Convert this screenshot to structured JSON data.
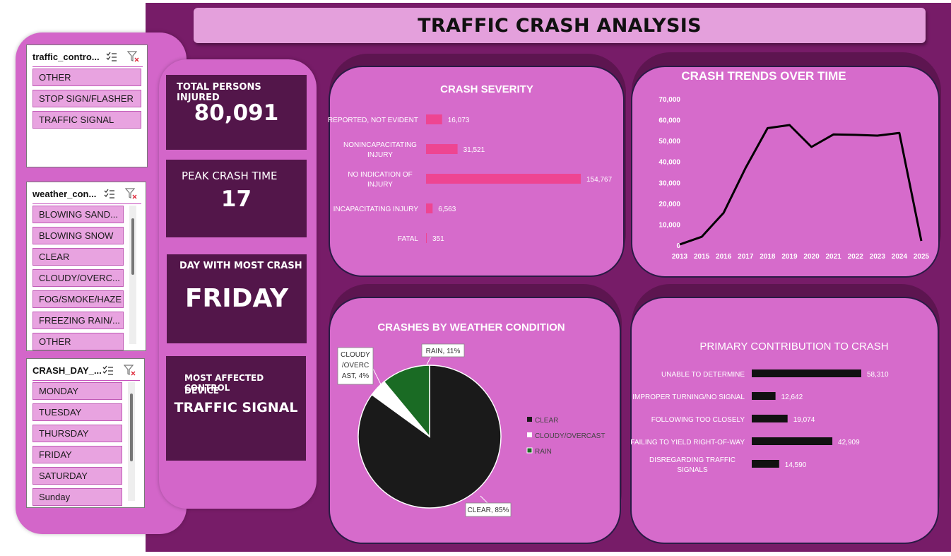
{
  "title": "TRAFFIC CRASH ANALYSIS",
  "slicers": {
    "traffic_control": {
      "title": "traffic_contro...",
      "items": [
        "OTHER",
        "STOP SIGN/FLASHER",
        "TRAFFIC SIGNAL"
      ]
    },
    "weather": {
      "title": "weather_con...",
      "items": [
        "BLOWING SAND...",
        "BLOWING SNOW",
        "CLEAR",
        "CLOUDY/OVERC...",
        "FOG/SMOKE/HAZE",
        "FREEZING RAIN/...",
        "OTHER"
      ]
    },
    "crash_day": {
      "title": "CRASH_DAY_...",
      "items": [
        "MONDAY",
        "TUESDAY",
        "THURSDAY",
        "FRIDAY",
        "SATURDAY",
        "Sunday"
      ]
    }
  },
  "kpis": {
    "injured": {
      "label": "TOTAL PERSONS INJURED",
      "value": "80,091"
    },
    "peak": {
      "label": "PEAK CRASH TIME",
      "value": "17"
    },
    "day": {
      "label": "DAY WITH MOST CRASH",
      "value": "FRIDAY"
    },
    "device": {
      "label_line1": "MOST AFFECTED CONTROL",
      "label_line2": "DEVICE",
      "value": "TRAFFIC SIGNAL"
    }
  },
  "colors": {
    "background": "#771c68",
    "card": "#d66bcb",
    "kpi": "#53164a",
    "bar_pink": "#ee4592",
    "bar_black": "#111111",
    "pie_clear": "#1a1a1a",
    "pie_cloudy": "#ffffff",
    "pie_rain": "#1a6b24"
  },
  "chart_data": [
    {
      "type": "bar",
      "title": "CRASH SEVERITY",
      "categories": [
        "REPORTED, NOT EVIDENT",
        "NONINCAPACITATING INJURY",
        "NO INDICATION OF INJURY",
        "INCAPACITATING INJURY",
        "FATAL"
      ],
      "category_lines": [
        [
          "REPORTED, NOT EVIDENT"
        ],
        [
          "NONINCAPACITATING",
          "INJURY"
        ],
        [
          "NO INDICATION OF",
          "INJURY"
        ],
        [
          "INCAPACITATING INJURY"
        ],
        [
          "FATAL"
        ]
      ],
      "values": [
        16073,
        31521,
        154767,
        6563,
        351
      ],
      "labels": [
        "16,073",
        "31,521",
        "154,767",
        "6,563",
        "351"
      ],
      "orientation": "horizontal"
    },
    {
      "type": "line",
      "title": "CRASH TRENDS OVER TIME",
      "x": [
        "2013",
        "2015",
        "2016",
        "2017",
        "2018",
        "2019",
        "2020",
        "2021",
        "2022",
        "2023",
        "2024",
        "2025"
      ],
      "values": [
        300,
        4000,
        15500,
        37000,
        56000,
        57500,
        47000,
        53000,
        52800,
        52400,
        53700,
        2000
      ],
      "ylim": [
        0,
        70000
      ],
      "yticks": [
        "0",
        "10,000",
        "20,000",
        "30,000",
        "40,000",
        "50,000",
        "60,000",
        "70,000"
      ],
      "grid": false
    },
    {
      "type": "pie",
      "title": "CRASHES BY WEATHER CONDITION",
      "categories": [
        "CLEAR",
        "CLOUDY/OVERCAST",
        "RAIN"
      ],
      "values": [
        85,
        4,
        11
      ],
      "data_labels": [
        [
          "CLEAR, 85%"
        ],
        [
          "CLOUDY",
          "/OVERC",
          "AST, 4%"
        ],
        [
          "RAIN, 11%"
        ]
      ],
      "legend": "right"
    },
    {
      "type": "bar",
      "title": "PRIMARY CONTRIBUTION TO CRASH",
      "categories": [
        "UNABLE TO DETERMINE",
        "IMPROPER TURNING/NO SIGNAL",
        "FOLLOWING TOO CLOSELY",
        "FAILING TO YIELD RIGHT-OF-WAY",
        "DISREGARDING TRAFFIC SIGNALS"
      ],
      "category_lines": [
        [
          "UNABLE TO DETERMINE"
        ],
        [
          "IMPROPER TURNING/NO SIGNAL"
        ],
        [
          "FOLLOWING TOO CLOSELY"
        ],
        [
          "FAILING TO YIELD RIGHT-OF-WAY"
        ],
        [
          "DISREGARDING TRAFFIC",
          "SIGNALS"
        ]
      ],
      "values": [
        58310,
        12642,
        19074,
        42909,
        14590
      ],
      "labels": [
        "58,310",
        "12,642",
        "19,074",
        "42,909",
        "14,590"
      ],
      "orientation": "horizontal"
    }
  ]
}
